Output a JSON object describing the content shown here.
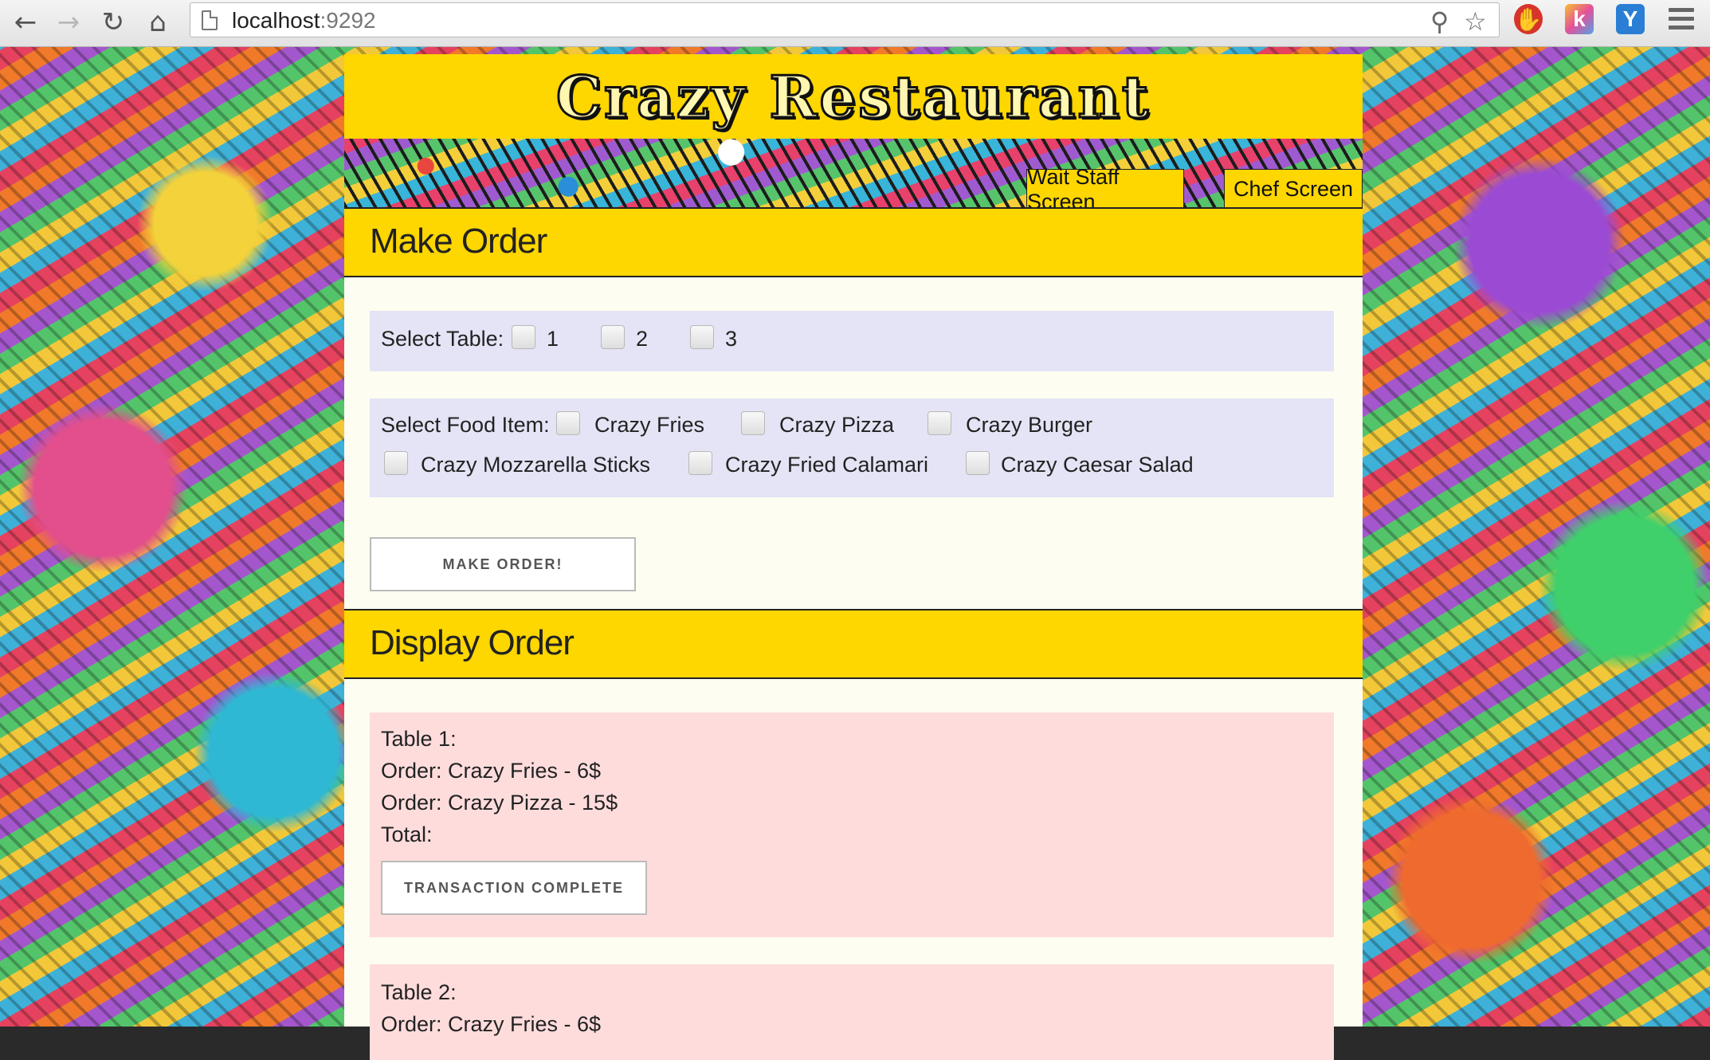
{
  "browser": {
    "url_host": "localhost",
    "url_port": ":9292"
  },
  "site": {
    "title": "Crazy Restaurant",
    "nav": [
      "Wait Staff Screen",
      "Chef Screen"
    ]
  },
  "make_order": {
    "heading": "Make Order",
    "table_label": "Select Table:",
    "tables": [
      "1",
      "2",
      "3"
    ],
    "food_label": "Select Food Item:",
    "foods": [
      "Crazy Fries",
      "Crazy Pizza",
      "Crazy Burger",
      "Crazy Mozzarella Sticks",
      "Crazy Fried Calamari",
      "Crazy Caesar Salad"
    ],
    "submit": "MAKE ORDER!"
  },
  "display_order": {
    "heading": "Display Order",
    "orders": [
      {
        "table": "Table 1:",
        "items": [
          "Order: Crazy Fries - 6$",
          "Order: Crazy Pizza - 15$"
        ],
        "total": "Total:",
        "button": "TRANSACTION COMPLETE"
      },
      {
        "table": "Table 2:",
        "items": [
          "Order: Crazy Fries - 6$"
        ]
      }
    ]
  }
}
